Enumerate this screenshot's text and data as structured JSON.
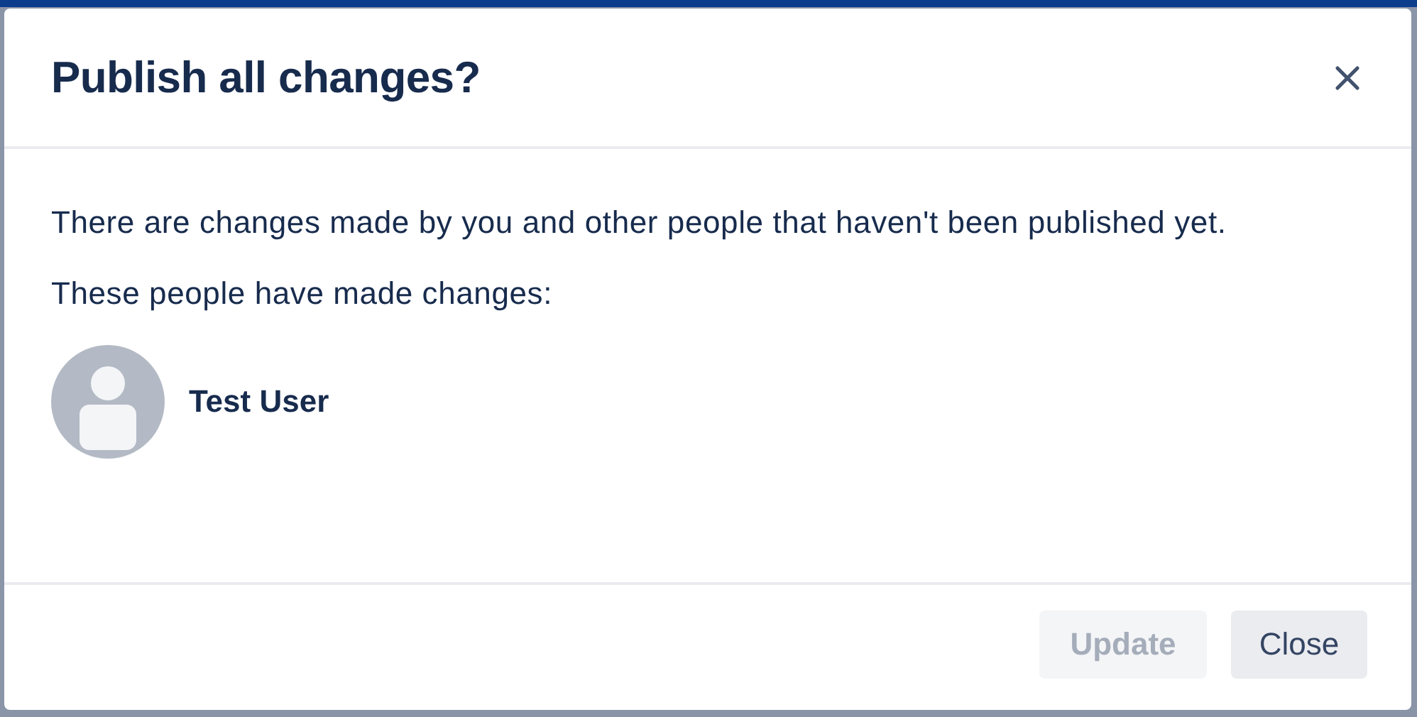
{
  "dialog": {
    "title": "Publish all changes?",
    "message": "There are changes made by you and other people that haven't been published yet.",
    "people_heading": "These people have made changes:",
    "people": [
      {
        "name": "Test User"
      }
    ],
    "buttons": [
      {
        "label": "Update",
        "disabled": true
      },
      {
        "label": "Close",
        "disabled": false
      }
    ]
  }
}
